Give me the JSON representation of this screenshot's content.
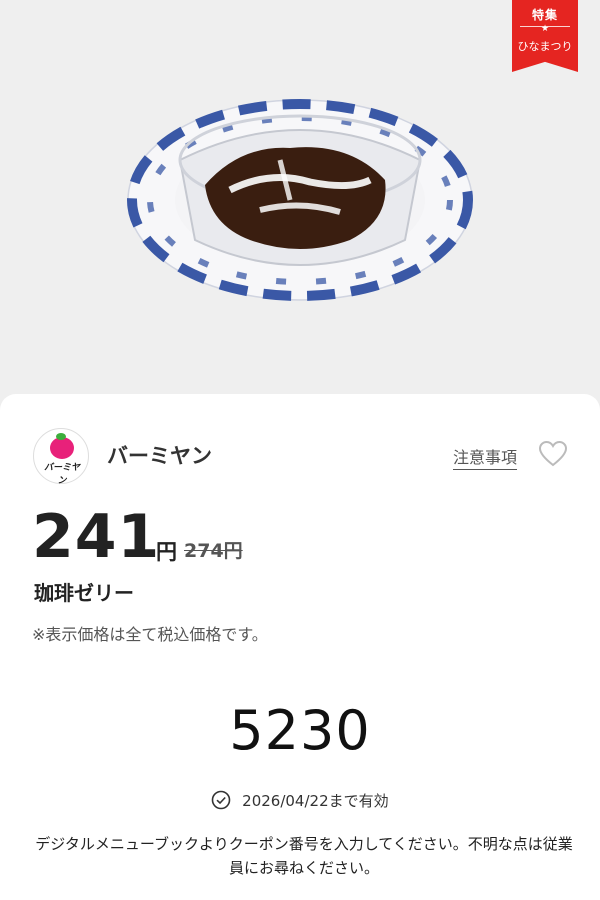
{
  "ribbon": {
    "line1": "特集",
    "line2": "ひなまつり"
  },
  "shop": {
    "name": "バーミヤン",
    "logo_text": "バーミヤン"
  },
  "notice_link": "注意事項",
  "price": {
    "current": "241",
    "unit": "円",
    "original": "274円"
  },
  "product_name": "珈琲ゼリー",
  "tax_note": "※表示価格は全て税込価格です。",
  "coupon_code": "5230",
  "validity": "2026/04/22まで有効",
  "instructions": "デジタルメニューブックよりクーポン番号を入力してください。不明な点は従業員にお尋ねください。",
  "colors": {
    "accent": "#e52521",
    "logo_peach": "#e8217a"
  },
  "icons": {
    "heart": "heart-icon",
    "check": "check-circle-icon"
  }
}
